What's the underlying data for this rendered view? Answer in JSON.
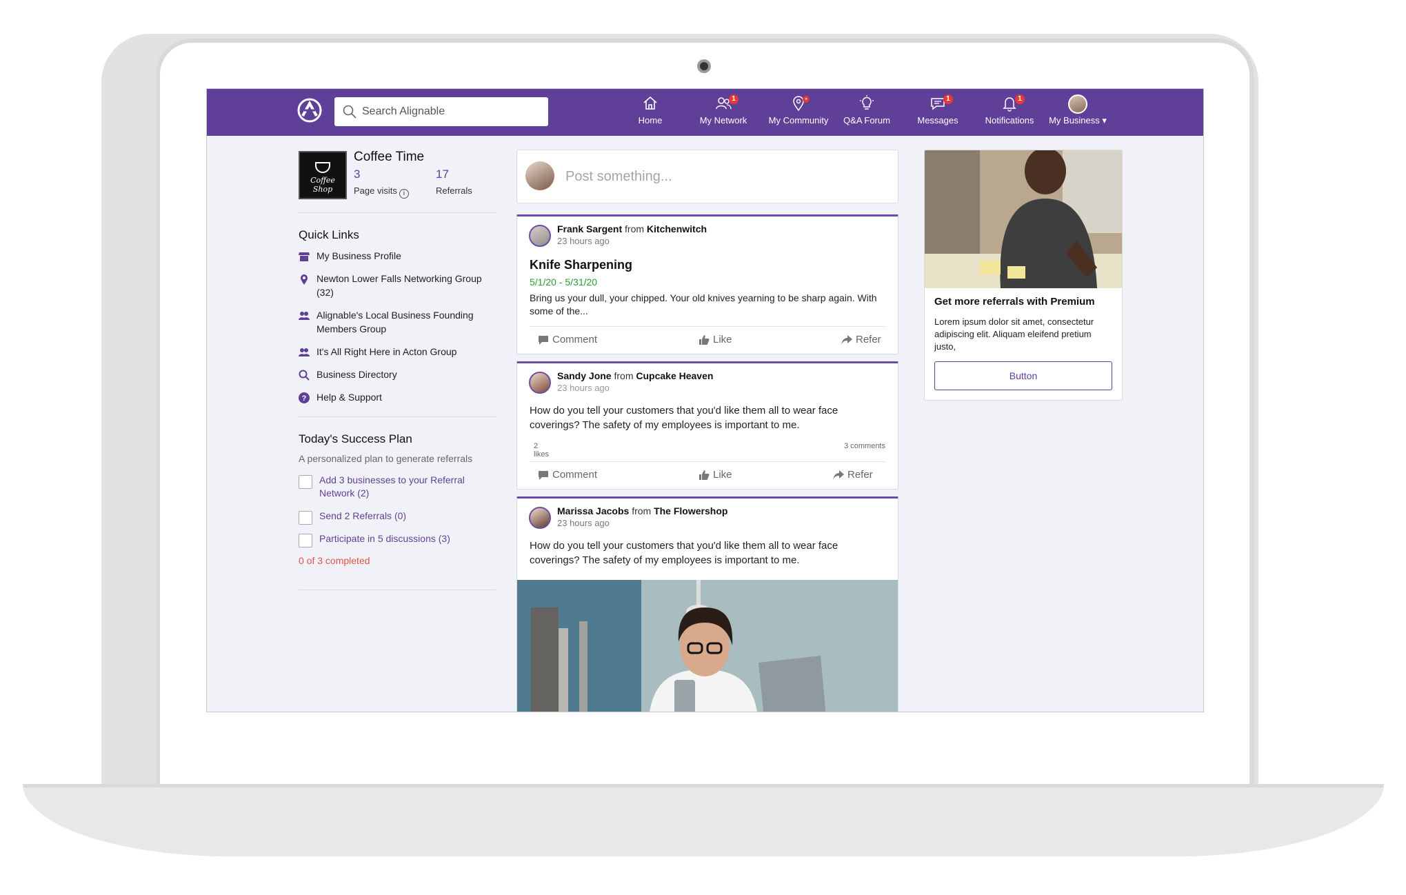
{
  "nav": {
    "search_placeholder": "Search Alignable",
    "items": [
      {
        "label": "Home",
        "icon": "home-icon"
      },
      {
        "label": "My Network",
        "icon": "people-icon",
        "badge": "1"
      },
      {
        "label": "My Community",
        "icon": "location-pin-icon",
        "badge": "•"
      },
      {
        "label": "Q&A Forum",
        "icon": "lightbulb-icon"
      },
      {
        "label": "Messages",
        "icon": "chat-bubble-icon",
        "badge": "1"
      },
      {
        "label": "Notifications",
        "icon": "bell-icon",
        "badge": "1"
      },
      {
        "label": "My Business ▾",
        "icon": "avatar"
      }
    ]
  },
  "business": {
    "name": "Coffee Time",
    "logo_text": "Coffee Shop",
    "page_visits": "3",
    "page_visits_label": "Page visits",
    "referrals": "17",
    "referrals_label": "Referrals"
  },
  "quick_links": {
    "title": "Quick Links",
    "items": [
      {
        "label": "My Business Profile",
        "icon": "storefront-icon"
      },
      {
        "label": "Newton Lower Falls Networking Group (32)",
        "icon": "location-pin-icon"
      },
      {
        "label": "Alignable's Local Business Founding Members Group",
        "icon": "group-icon"
      },
      {
        "label": "It's All Right Here in Acton Group",
        "icon": "group-icon"
      },
      {
        "label": "Business Directory",
        "icon": "search-icon"
      },
      {
        "label": "Help & Support",
        "icon": "help-icon"
      }
    ]
  },
  "success_plan": {
    "title": "Today's Success Plan",
    "subtitle": "A personalized plan to generate referrals",
    "items": [
      {
        "label": "Add 3 businesses to your Referral Network (2)"
      },
      {
        "label": "Send 2 Referrals (0)"
      },
      {
        "label": "Participate in 5 discussions (3)"
      }
    ],
    "completed": "0 of 3 completed"
  },
  "composer": {
    "placeholder": "Post something..."
  },
  "posts": [
    {
      "author": "Frank Sargent",
      "from": "from",
      "business": "Kitchenwitch",
      "time": "23 hours ago",
      "title": "Knife Sharpening",
      "dates": "5/1/20 - 5/31/20",
      "body": "Bring us your dull, your chipped. Your old knives yearning to be sharp again. With some of the...",
      "actions": {
        "comment": "Comment",
        "like": "Like",
        "refer": "Refer"
      }
    },
    {
      "author": "Sandy Jone",
      "from": "from",
      "business": "Cupcake Heaven",
      "time": "23 hours ago",
      "body": "How do you tell your customers that you'd like them all to wear face coverings? The safety of my employees is important to me.",
      "likes_count": "2",
      "likes_label": "likes",
      "comments": "3 comments",
      "actions": {
        "comment": "Comment",
        "like": "Like",
        "refer": "Refer"
      }
    },
    {
      "author": "Marissa Jacobs",
      "from": "from",
      "business": "The Flowershop",
      "time": "23 hours ago",
      "body": "How do you tell your customers that you'd like them all to wear face coverings? The safety of my employees is important to me."
    }
  ],
  "promo": {
    "title": "Get more referrals with Premium",
    "body": "Lorem ipsum dolor sit amet, consectetur adipiscing elit. Aliquam eleifend pretium justo,",
    "button": "Button"
  },
  "colors": {
    "brand": "#5f3f98",
    "badge": "#e53935",
    "success": "#2e9b33",
    "alert": "#e0524a"
  }
}
